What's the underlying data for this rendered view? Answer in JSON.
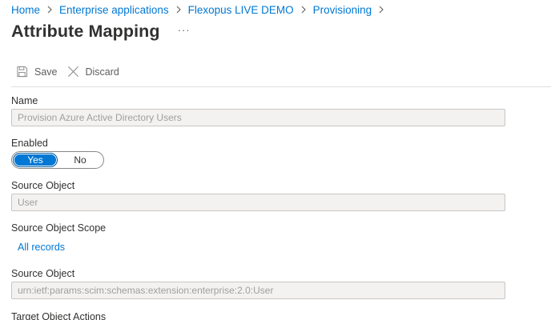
{
  "breadcrumb": {
    "items": [
      "Home",
      "Enterprise applications",
      "Flexopus LIVE DEMO",
      "Provisioning"
    ]
  },
  "page": {
    "title": "Attribute Mapping",
    "more_label": "···"
  },
  "toolbar": {
    "save_label": "Save",
    "discard_label": "Discard"
  },
  "form": {
    "name_label": "Name",
    "name_value": "Provision Azure Active Directory Users",
    "enabled_label": "Enabled",
    "enabled_options": [
      "Yes",
      "No"
    ],
    "enabled_selected": "Yes",
    "source_object_label": "Source Object",
    "source_object_value": "User",
    "source_scope_label": "Source Object Scope",
    "source_scope_link": "All records",
    "source_object2_label": "Source Object",
    "source_object2_value": "urn:ietf:params:scim:schemas:extension:enterprise:2.0:User",
    "target_actions_label": "Target Object Actions"
  },
  "colors": {
    "accent": "#0078d4",
    "text": "#323130",
    "disabled_text": "#a19f9d",
    "field_bg": "#f3f2f1"
  }
}
